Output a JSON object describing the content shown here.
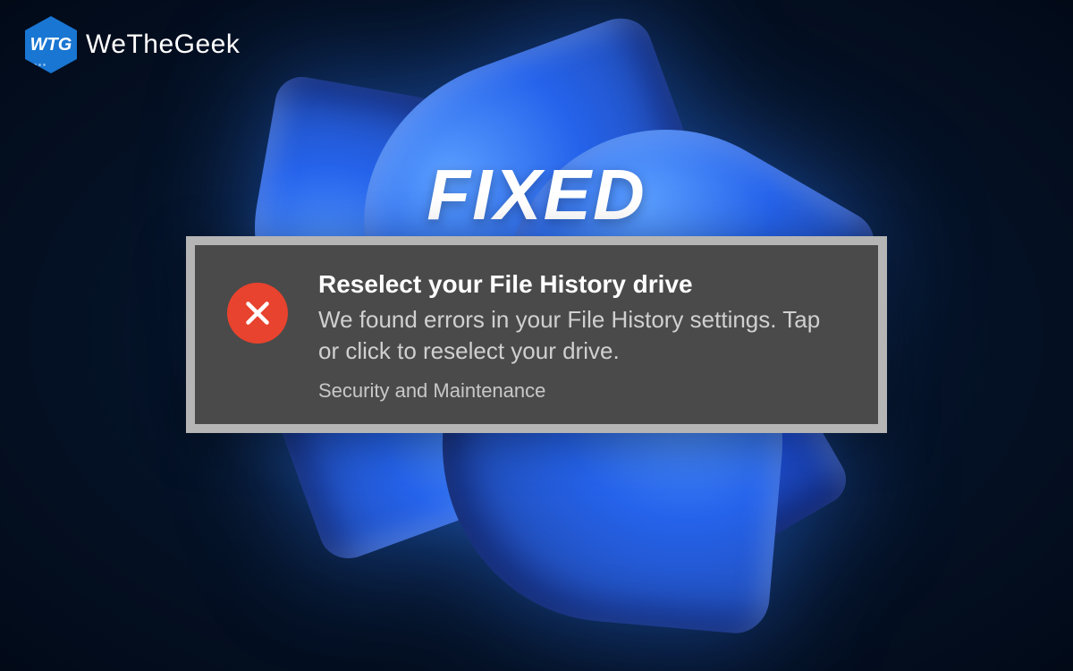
{
  "logo": {
    "badge_text": "WTG",
    "brand_text": "WeTheGeek"
  },
  "heading": {
    "text": "FIXED"
  },
  "notification": {
    "title": "Reselect your File History drive",
    "body": "We found errors in your File History settings. Tap or click to reselect your drive.",
    "source": "Security and Maintenance",
    "icon_name": "error-cross"
  },
  "colors": {
    "error_icon": "#e8432e",
    "notification_bg": "#4a4a4a",
    "notification_border": "#b5b5b5"
  }
}
